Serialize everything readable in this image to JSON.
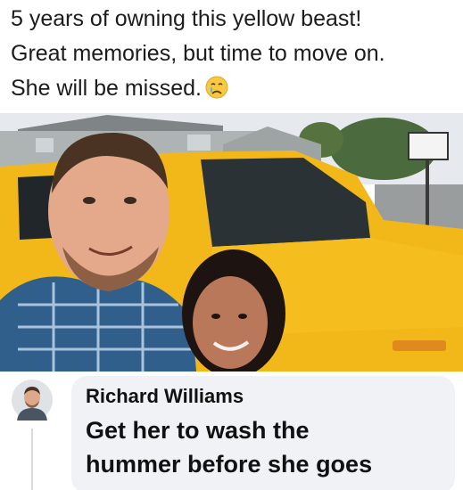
{
  "post": {
    "caption_lines": [
      "5 years of owning this yellow beast!",
      "Great memories, but time to move on.",
      "She will be missed."
    ],
    "caption_emoji": "crying-face-emoji"
  },
  "photo": {
    "subject_colors": {
      "vehicle": "#f2b81a",
      "sky": "#e6e9ed",
      "house": "#aeb3b4",
      "shirt": "#2f5f8a"
    }
  },
  "comment": {
    "author": "Richard Williams",
    "text_lines": [
      "Get her to wash the",
      "hummer before she goes"
    ],
    "bubble_color": "#f0f2f5"
  }
}
